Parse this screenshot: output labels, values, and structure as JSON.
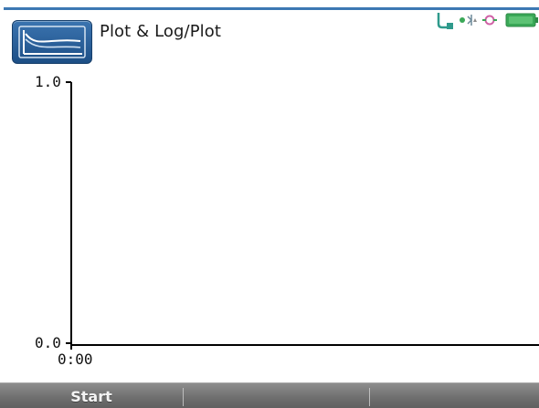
{
  "app": {
    "title": "Plot & Log/Plot",
    "icon": "plot-log-icon"
  },
  "status_bar": {
    "icons": [
      "network-icon",
      "bluetooth-icon",
      "power-plug-icon",
      "battery-icon"
    ]
  },
  "plot": {
    "y_max_label": "1.0",
    "y_min_label": "0.0",
    "x_min_label": "0:00"
  },
  "softkeys": {
    "key1_label": "Start",
    "key2_label": "",
    "key3_label": ""
  },
  "colors": {
    "frame_blue": "#3d78b3",
    "softkey_bar": "#767676",
    "status_green": "#3aa857"
  }
}
